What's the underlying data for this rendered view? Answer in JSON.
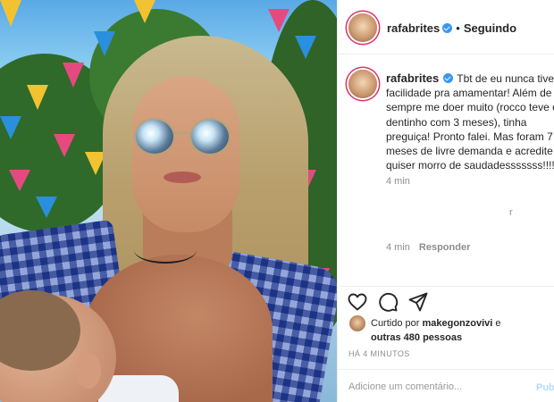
{
  "post": {
    "username": "rafabrites",
    "follow_separator": "•",
    "follow_status": "Seguindo",
    "caption_lines": [
      "Tbt de eu nunca tive",
      "facilidade pra amamentar! Além de",
      "sempre me doer muito (rocco teve o",
      "dentinho com 3 meses), tinha",
      "preguiça! Pronto falei. Mas foram 7",
      "meses de livre demanda e acredite se",
      "quiser morro de saudadesssssss!!!!!!"
    ],
    "caption_time": "4 min",
    "stray_char": "r",
    "comment_time": "4 min",
    "reply_label": "Responder",
    "liked_by_prefix": "Curtido por",
    "liked_by_user": "makegonzovivi",
    "liked_by_and": "e",
    "liked_by_others": "outras 480 pessoas",
    "timestamp": "HÁ 4 MINUTOS",
    "comment_placeholder": "Adicione um comentário...",
    "post_label": "Publicar"
  },
  "colors": {
    "verified": "#3897f0",
    "post_button_disabled": "#b3dbff",
    "story_ring": "#e1306c"
  },
  "icons": [
    "heart-icon",
    "comment-icon",
    "share-icon",
    "verified-badge-icon"
  ]
}
